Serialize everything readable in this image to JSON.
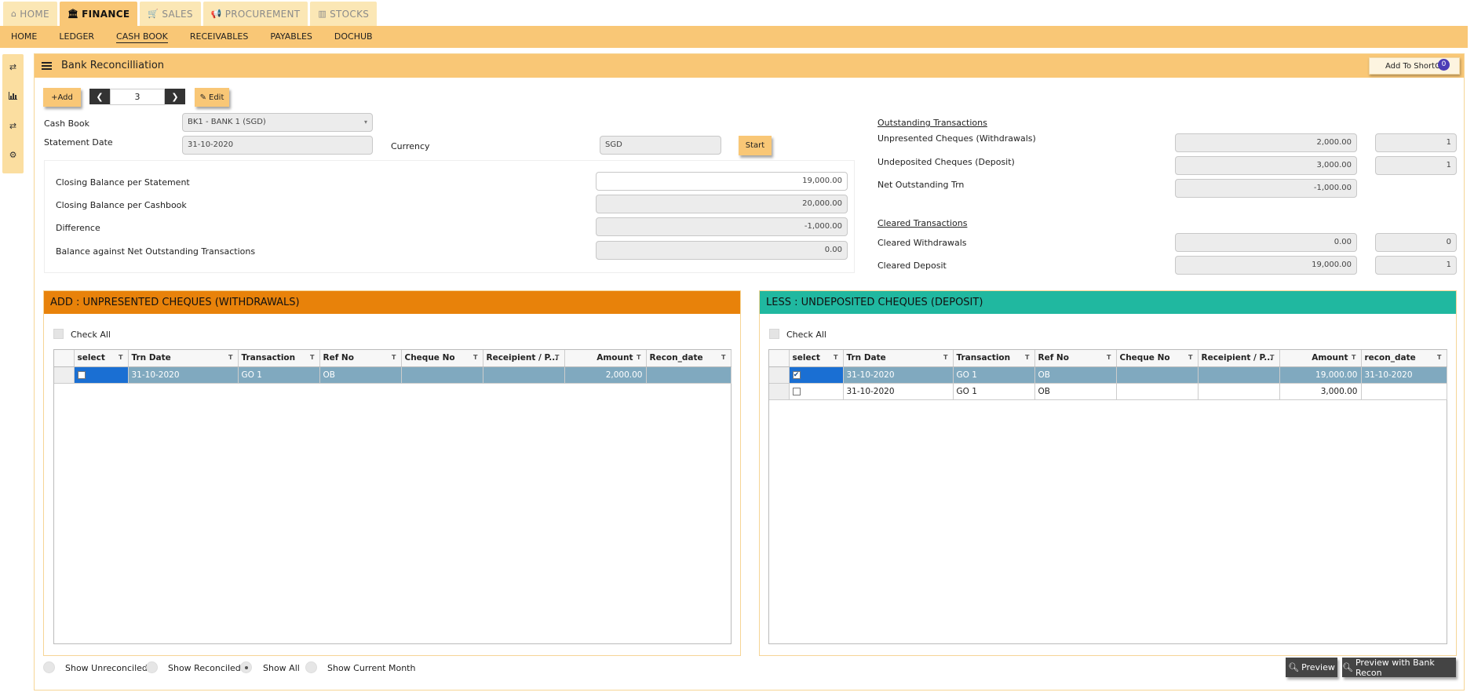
{
  "top_tabs": [
    {
      "icon": "⌂",
      "label": "HOME"
    },
    {
      "icon": "🏛",
      "label": "FINANCE"
    },
    {
      "icon": "🛒",
      "label": "SALES"
    },
    {
      "icon": "📢",
      "label": "PROCUREMENT"
    },
    {
      "icon": "▥",
      "label": "STOCKS"
    }
  ],
  "sub_nav": [
    "HOME",
    "LEDGER",
    "CASH BOOK",
    "RECEIVABLES",
    "PAYABLES",
    "DOCHUB"
  ],
  "page": {
    "title": "Bank Reconcilliation",
    "shortcut_label": "Add To ShortCut",
    "shortcut_count": "0"
  },
  "toolbar": {
    "add_label": "+Add",
    "record_number": "3",
    "edit_label": "Edit"
  },
  "form": {
    "cash_book_label": "Cash Book",
    "cash_book_value": "BK1 - BANK 1 (SGD)",
    "statement_date_label": "Statement Date",
    "statement_date_value": "31-10-2020",
    "currency_label": "Currency",
    "currency_value": "SGD",
    "start_label": "Start"
  },
  "balances": {
    "closing_statement_label": "Closing Balance per Statement",
    "closing_statement_value": "19,000.00",
    "closing_cashbook_label": "Closing Balance per Cashbook",
    "closing_cashbook_value": "20,000.00",
    "difference_label": "Difference",
    "difference_value": "-1,000.00",
    "balance_net_label": "Balance against Net Outstanding Transactions",
    "balance_net_value": "0.00"
  },
  "outstanding": {
    "heading": "Outstanding Transactions",
    "unpresented_label": "Unpresented Cheques (Withdrawals)",
    "unpresented_amount": "2,000.00",
    "unpresented_count": "1",
    "undeposited_label": "Undeposited Cheques (Deposit)",
    "undeposited_amount": "3,000.00",
    "undeposited_count": "1",
    "net_label": "Net Outstanding Trn",
    "net_amount": "-1,000.00"
  },
  "cleared": {
    "heading": "Cleared Transactions",
    "withdrawals_label": "Cleared Withdrawals",
    "withdrawals_amount": "0.00",
    "withdrawals_count": "0",
    "deposit_label": "Cleared Deposit",
    "deposit_amount": "19,000.00",
    "deposit_count": "1"
  },
  "left_grid": {
    "title": "ADD : UNPRESENTED CHEQUES (WITHDRAWALS)",
    "check_all": "Check All",
    "columns": [
      "select",
      "Trn Date",
      "Transaction",
      "Ref No",
      "Cheque No",
      "Receipient / P...",
      "Amount",
      "Recon_date"
    ],
    "rows": [
      {
        "checked": false,
        "trn_date": "31-10-2020",
        "transaction": "GO 1",
        "ref_no": "OB",
        "cheque_no": "",
        "recipient": "",
        "amount": "2,000.00",
        "recon_date": ""
      }
    ]
  },
  "right_grid": {
    "title": "LESS : UNDEPOSITED CHEQUES (DEPOSIT)",
    "check_all": "Check All",
    "columns": [
      "select",
      "Trn Date",
      "Transaction",
      "Ref No",
      "Cheque No",
      "Receipient / P...",
      "Amount",
      "recon_date"
    ],
    "rows": [
      {
        "checked": true,
        "trn_date": "31-10-2020",
        "transaction": "GO 1",
        "ref_no": "OB",
        "cheque_no": "",
        "recipient": "",
        "amount": "19,000.00",
        "recon_date": "31-10-2020"
      },
      {
        "checked": false,
        "trn_date": "31-10-2020",
        "transaction": "GO 1",
        "ref_no": "OB",
        "cheque_no": "",
        "recipient": "",
        "amount": "3,000.00",
        "recon_date": ""
      }
    ]
  },
  "filters": [
    "Show Unreconciled",
    "Show Reconciled",
    "Show All",
    "Show Current Month"
  ],
  "footer": {
    "preview_label": "Preview",
    "preview_recon_label": "Preview with Bank Recon"
  },
  "colors": {
    "accent": "#f9c776",
    "left_header": "#e8820a",
    "right_header": "#20b8a0",
    "selected_row": "#80a9bf"
  }
}
